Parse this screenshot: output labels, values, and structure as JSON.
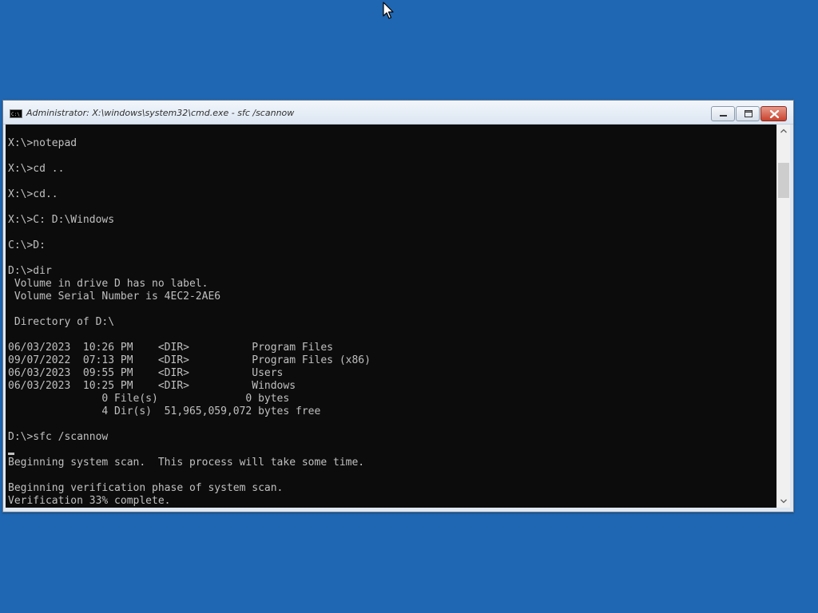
{
  "window": {
    "title": "Administrator: X:\\windows\\system32\\cmd.exe - sfc  /scannow",
    "icon": "cmd-console-icon",
    "buttons": {
      "minimize": "minimize-icon",
      "maximize": "maximize-icon",
      "close": "close-icon"
    }
  },
  "console": {
    "lines": [
      "X:\\>notepad",
      "",
      "X:\\>cd ..",
      "",
      "X:\\>cd..",
      "",
      "X:\\>C: D:\\Windows",
      "",
      "C:\\>D:",
      "",
      "D:\\>dir",
      " Volume in drive D has no label.",
      " Volume Serial Number is 4EC2-2AE6",
      "",
      " Directory of D:\\",
      "",
      "06/03/2023  10:26 PM    <DIR>          Program Files",
      "09/07/2022  07:13 PM    <DIR>          Program Files (x86)",
      "06/03/2023  09:55 PM    <DIR>          Users",
      "06/03/2023  10:25 PM    <DIR>          Windows",
      "               0 File(s)              0 bytes",
      "               4 Dir(s)  51,965,059,072 bytes free",
      "",
      "D:\\>sfc /scannow",
      "",
      "Beginning system scan.  This process will take some time.",
      "",
      "Beginning verification phase of system scan.",
      "Verification 33% complete."
    ]
  },
  "scrollbar": {
    "up_icon": "scroll-up-arrow-icon",
    "down_icon": "scroll-down-arrow-icon",
    "position_fraction": 0.1
  },
  "colors": {
    "desktop": "#1f67b2",
    "console_bg": "#0c0c0c",
    "console_text": "#c0c0c0"
  }
}
